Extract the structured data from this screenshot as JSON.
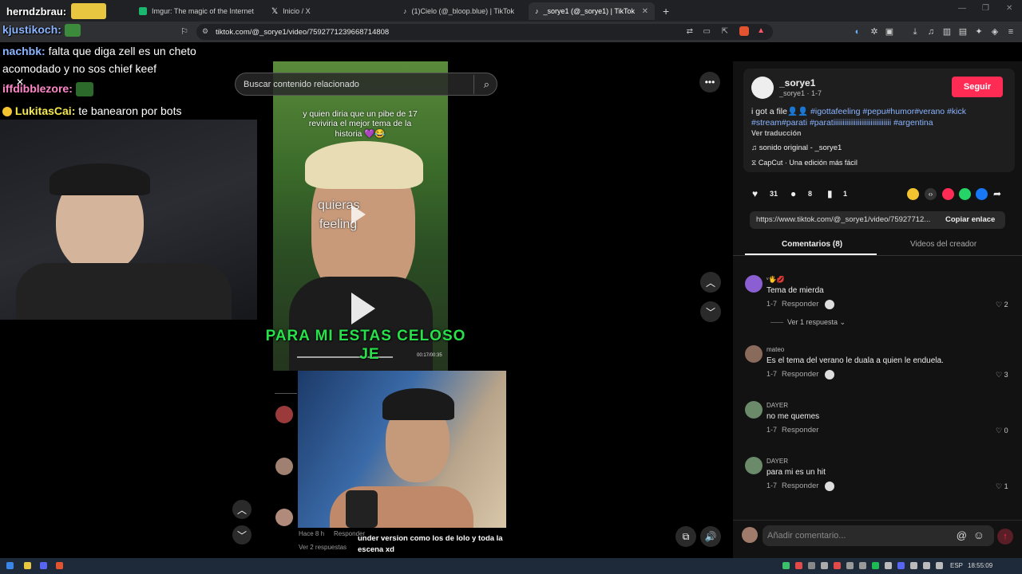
{
  "tabs": [
    {
      "label": "herndzbrau:",
      "color": "#ffffff"
    },
    {
      "label": "Imgur: The magic of the Internet",
      "color": "#1bb76e"
    },
    {
      "label": "Inicio / X",
      "color": "#000000"
    },
    {
      "label": "(1)Cielo (@_bloop.blue) | TikTok",
      "color": "#111111"
    },
    {
      "label": "_sorye1 (@_sorye1) | TikTok",
      "color": "#111111",
      "close": "✕"
    }
  ],
  "new_tab": "+",
  "browser": {
    "url": "tiktok.com/@_sorye1/video/7592771239668714808"
  },
  "chat": [
    {
      "user": "kjustikoch:",
      "msg": "",
      "color": "#8ab4ff"
    },
    {
      "user": "nachbk:",
      "msg": "falta que diga zell es un cheto",
      "color": "#8ab4ff"
    },
    {
      "user": "",
      "msg": "acomodado y no sos chief keef",
      "color": "#ffffff"
    },
    {
      "user": "iffdibblezore:",
      "msg": "",
      "color": "#ff86c8"
    },
    {
      "user": "LukitasCai:",
      "msg": "te banearon por bots",
      "color": "#f4e84a"
    }
  ],
  "search": {
    "placeholder": "Buscar contenido relacionado"
  },
  "video": {
    "caption_top": "y quien diria que un pibe de 17 reviviria el mejor tema de la historia 💜😂",
    "lyric1": "quieras",
    "lyric2": "feeling",
    "overlay1": "PARA MI ESTAS CELOSO",
    "overlay2": "JE",
    "time": "00:17/00:35"
  },
  "reaction": {
    "time_ago": "Hace 8 h",
    "reply": "Responder",
    "see_replies": "Ver 2 respuestas",
    "subtitle": "under version como los de lolo y toda la escena xd"
  },
  "post": {
    "username": "_sorye1",
    "handle": "_sorye1 · 1-7",
    "follow": "Seguir",
    "desc_start": "i got a file👤👤 ",
    "hashtags": "#igottafeeling #pepu#humor#verano #kick #stream#parati #paratiiiiiiiiiiiiiiiiiiiiiiiiiiiiiii #argentina",
    "translate": "Ver traducción",
    "sound": "sonido original - _sorye1",
    "capcut": "CapCut · Una edición más fácil",
    "likes": "31",
    "comments": "8",
    "saves": "1",
    "link": "https://www.tiktok.com/@_sorye1/video/75927712...",
    "copy": "Copiar enlace"
  },
  "tabs_panel": {
    "comments": "Comentarios (8)",
    "creator": "Videos del creador"
  },
  "comments": [
    {
      "user": "ᵛ🖐💋",
      "text": "Tema de mierda",
      "date": "1-7",
      "reply": "Responder",
      "likes": "2",
      "more": "Ver 1 respuesta",
      "avatar": "#8b5fd1"
    },
    {
      "user": "mateo",
      "text": "Es el tema del verano le duala a quien le enduela.",
      "date": "1-7",
      "reply": "Responder",
      "likes": "3",
      "avatar": "#8a6a5a"
    },
    {
      "user": "DAYER",
      "text": "no me quemes",
      "date": "1-7",
      "reply": "Responder",
      "likes": "0",
      "avatar": "#6a8a6a"
    },
    {
      "user": "DAYER",
      "text": "para mi es un hit",
      "date": "1-7",
      "reply": "Responder",
      "likes": "1",
      "avatar": "#6a8a6a"
    }
  ],
  "add_comment": {
    "placeholder": "Añadir comentario..."
  },
  "taskbar": {
    "lang": "ESP",
    "time": "18:55:09"
  }
}
